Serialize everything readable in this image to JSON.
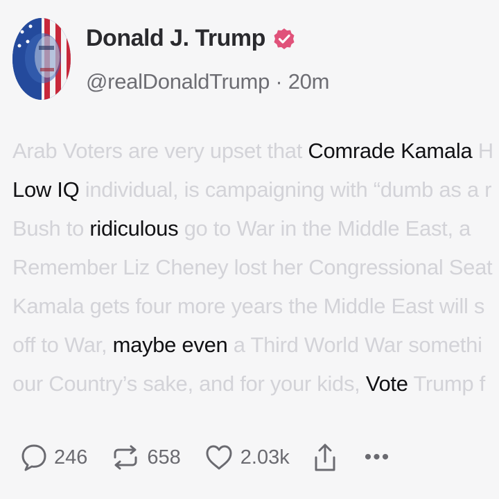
{
  "author": {
    "name": "Donald J. Trump",
    "handle": "@realDonaldTrump",
    "separator": "·",
    "time": "20m",
    "verified_color": "#e0527a"
  },
  "post": {
    "lines": [
      [
        {
          "t": "Arab Voters are very upset that ",
          "hl": false
        },
        {
          "t": "Comrade Kamala",
          "hl": true
        },
        {
          "t": " H",
          "hl": false
        }
      ],
      [
        {
          "t": "Low IQ",
          "hl": true
        },
        {
          "t": " individual, is campaigning with “dumb as a r",
          "hl": false
        }
      ],
      [
        {
          "t": "Bush to ",
          "hl": false
        },
        {
          "t": "ridiculous",
          "hl": true
        },
        {
          "t": "   go to War in the Middle East, a",
          "hl": false
        }
      ],
      [
        {
          "t": "Remember  Liz Cheney lost her Congressional Seat",
          "hl": false
        }
      ],
      [
        {
          "t": "Kamala gets four more years  the Middle East will s",
          "hl": false
        }
      ],
      [
        {
          "t": "off to War, ",
          "hl": false
        },
        {
          "t": "maybe even",
          "hl": true
        },
        {
          "t": " a Third World War  somethi",
          "hl": false
        }
      ],
      [
        {
          "t": "our Country’s sake, and for your kids, ",
          "hl": false
        },
        {
          "t": "Vote",
          "hl": true
        },
        {
          "t": " Trump f",
          "hl": false
        }
      ]
    ]
  },
  "actions": {
    "replies": "246",
    "reposts": "658",
    "likes": "2.03k",
    "more_label": "•••"
  }
}
